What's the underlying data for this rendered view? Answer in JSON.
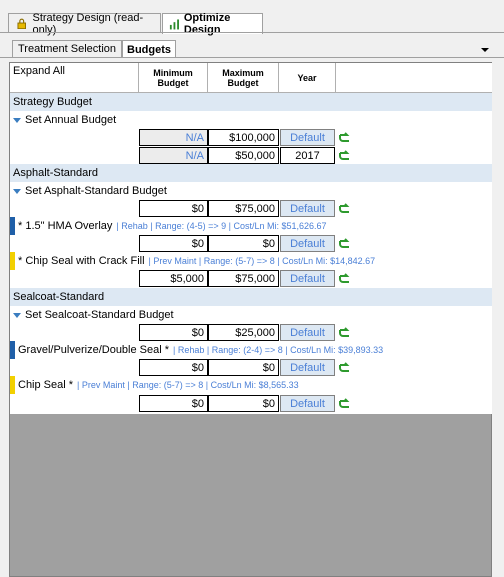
{
  "tabs": {
    "tab1": "Strategy Design (read-only)",
    "tab2": "Optimize Design",
    "sub1": "Treatment Selection",
    "sub2": "Budgets"
  },
  "header": {
    "expand_all": "Expand All",
    "min": "Minimum Budget",
    "max": "Maximum Budget",
    "year": "Year"
  },
  "sections": {
    "strategy": "Strategy Budget",
    "set_annual": "Set Annual Budget",
    "asphalt": "Asphalt-Standard",
    "set_asphalt": "Set Asphalt-Standard Budget",
    "sealcoat": "Sealcoat-Standard",
    "set_sealcoat": "Set Sealcoat-Standard Budget"
  },
  "rows": {
    "r1": {
      "min": "N/A",
      "max": "$100,000",
      "year": "Default"
    },
    "r2": {
      "min": "N/A",
      "max": "$50,000",
      "year": "2017"
    },
    "r3": {
      "min": "$0",
      "max": "$75,000",
      "year": "Default"
    },
    "r4": {
      "min": "$0",
      "max": "$0",
      "year": "Default"
    },
    "r5": {
      "min": "$5,000",
      "max": "$75,000",
      "year": "Default"
    },
    "r6": {
      "min": "$0",
      "max": "$25,000",
      "year": "Default"
    },
    "r7": {
      "min": "$0",
      "max": "$0",
      "year": "Default"
    },
    "r8": {
      "min": "$0",
      "max": "$0",
      "year": "Default"
    }
  },
  "treatments": {
    "t1": {
      "name": "* 1.5\" HMA Overlay",
      "meta": "| Rehab | Range: (4-5) => 9 | Cost/Ln Mi: $51,626.67",
      "color": "#1f5fa8"
    },
    "t2": {
      "name": "* Chip Seal with Crack Fill",
      "meta": "| Prev Maint | Range: (5-7) => 8 | Cost/Ln Mi: $14,842.67",
      "color": "#f2d000"
    },
    "t3": {
      "name": "Gravel/Pulverize/Double Seal *",
      "meta": "| Rehab | Range: (2-4) => 8 | Cost/Ln Mi: $39,893.33",
      "color": "#1f5fa8"
    },
    "t4": {
      "name": "Chip Seal *",
      "meta": "| Prev Maint | Range: (5-7) => 8 | Cost/Ln Mi: $8,565.33",
      "color": "#f2d000"
    }
  }
}
